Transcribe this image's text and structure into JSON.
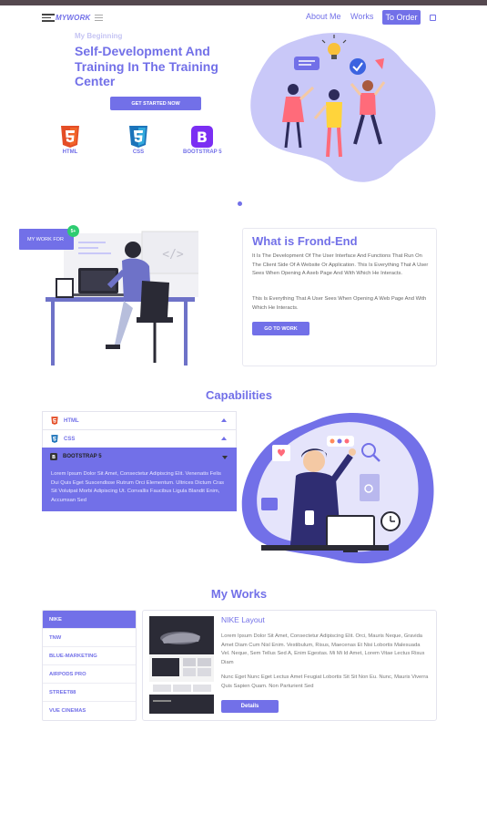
{
  "nav": {
    "logo_text": "MYWORK",
    "about_label": "About Me",
    "works_label": "Works",
    "order_label": "To Order"
  },
  "hero": {
    "kicker": "My Beginning",
    "title": "Self-Development And Training In The Training Center",
    "cta_label": "GET STARTED NOW",
    "technologies": [
      {
        "label": "HTML",
        "icon": "html5-icon",
        "color": "#e44d26"
      },
      {
        "label": "CSS",
        "icon": "css3-icon",
        "color": "#1b73ba"
      },
      {
        "label": "BOOTSTRAP 5",
        "icon": "bootstrap-icon",
        "color": "#7b2ef3"
      }
    ]
  },
  "frontend": {
    "badge_label": "MY WORK FOR",
    "badge_count": "5+",
    "code_glyph": "</>",
    "title": "What is Frond-End",
    "paragraph1": "It Is The Development Of The User Interface And Functions That Run On The Client Side Of A Website Or Application. This Is Everything That A User Sees When Opening A Axeb Page And With Which He Interacts.",
    "paragraph2": "This Is Everything That A User Sees When Opening A Web Page And With Which He Interacts.",
    "button_label": "GO TO WORK"
  },
  "capabilities": {
    "title": "Capabilities",
    "items": [
      {
        "label": "HTML",
        "icon": "html5-icon"
      },
      {
        "label": "CSS",
        "icon": "css3-icon"
      },
      {
        "label": "BOOTSTRAP 5",
        "icon": "bootstrap-icon"
      }
    ],
    "open_text": "Lorem Ipsum Dolor Sit Amet, Consectetur Adipiscing Elit. Venenatis Felis Dui Quis Eget Suscendisse Rutrum Orci Elementum. Ultrices Dictum Cras Sit Volutpat Morbi Adipiscing Ut. Convallis Faucibus Ligula Blandit Enim, Accumsan Sed"
  },
  "works": {
    "title": "My Works",
    "items": [
      "NIKE",
      "TNW",
      "BLUE-MARKETING",
      "AIRPODS PRO",
      "STREET88",
      "VUE CINEMAS"
    ],
    "heading": "NIKE Layout",
    "paragraph1": "Lorem Ipsum Dolor Sit Amet, Consectetur Adipiscing Elit. Orci, Mauris Neque, Gravida Amet Diam Cum Nisl Enim. Vestibulum, Risus, Maecenas Et Nisi Lobortis Malesuada Vel. Neque, Sem Tellus Sed A, Enim Egestas. Mi Mi Id Amet, Lorem Vitae Lectus Risus Diam",
    "paragraph2": "Nunc Eget Nunc Eget Lectus Amet Feugiat Lobortis Sit Sit Non Eu. Nunc, Mauris Viverra Quis Sapien Quam. Non Parturient Sed",
    "details_label": "Details"
  },
  "colors": {
    "accent": "#7270e8",
    "blob": "#c9c8f8",
    "badge_green": "#2ecc71"
  }
}
